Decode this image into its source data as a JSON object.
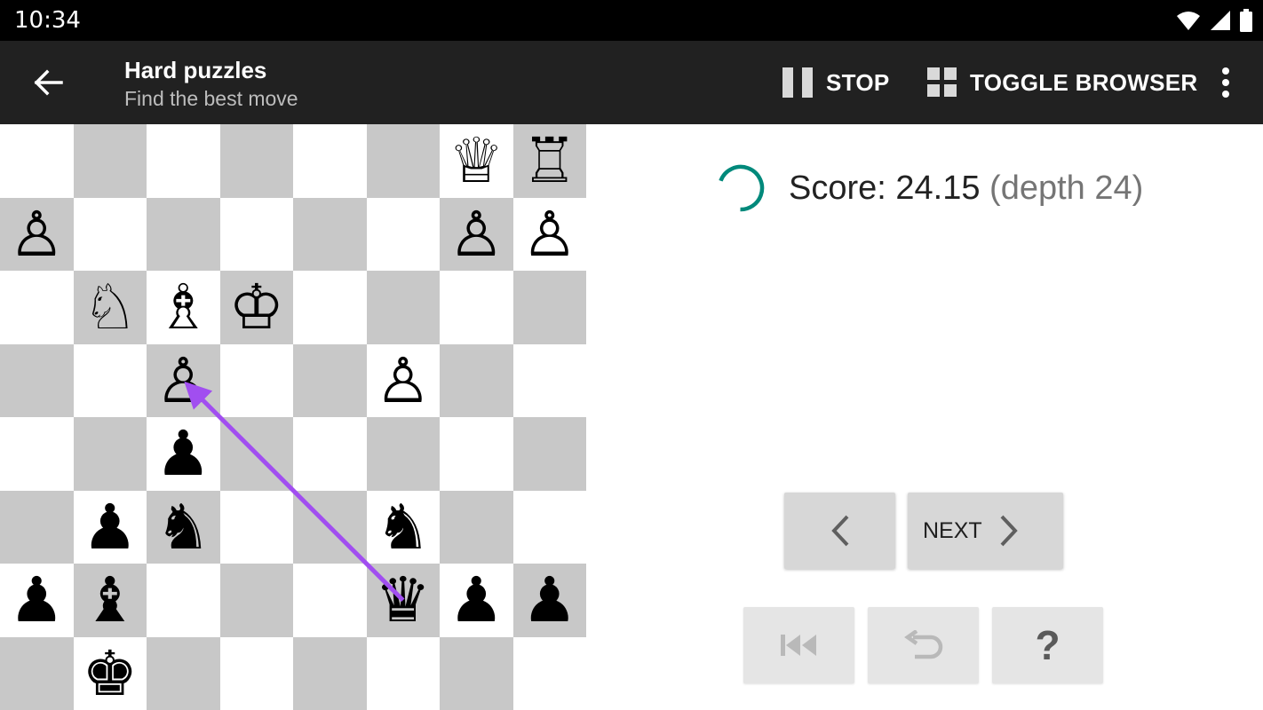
{
  "status_bar": {
    "time": "10:34"
  },
  "app_bar": {
    "title": "Hard puzzles",
    "subtitle": "Find the best move",
    "stop_label": "STOP",
    "toggle_browser_label": "TOGGLE BROWSER"
  },
  "board": {
    "light_color": "#ffffff",
    "dark_color": "#c8c8c8",
    "rows": [
      [
        "",
        "",
        "",
        "",
        "",
        "",
        "♕",
        "♖"
      ],
      [
        "♙",
        "",
        "",
        "",
        "",
        "",
        "♙",
        "♙"
      ],
      [
        "",
        "♘",
        "♗",
        "♔",
        "",
        "",
        "",
        ""
      ],
      [
        "",
        "",
        "♙",
        "",
        "",
        "♙",
        "",
        ""
      ],
      [
        "",
        "",
        "♟",
        "",
        "",
        "",
        "",
        ""
      ],
      [
        "",
        "♟",
        "♞",
        "",
        "",
        "♞",
        "",
        ""
      ],
      [
        "♟",
        "♝",
        "",
        "",
        "",
        "♛",
        "♟",
        "♟"
      ],
      [
        "",
        "♚",
        "",
        "",
        "",
        "",
        "",
        ""
      ]
    ],
    "arrow": {
      "from": [
        6,
        5
      ],
      "to": [
        3,
        2
      ],
      "color": "#a14ef0"
    }
  },
  "analysis": {
    "score_label": "Score: 24.15",
    "depth_label": "(depth 24)",
    "spinner_color": "#00897b"
  },
  "controls": {
    "next_label": "NEXT",
    "hint_label": "?"
  }
}
